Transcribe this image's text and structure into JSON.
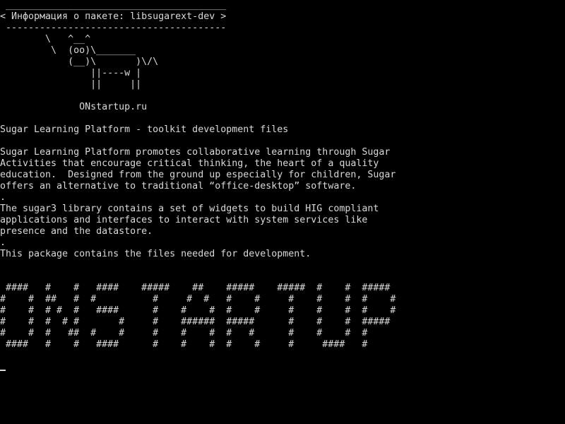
{
  "terminal": {
    "lines": [
      " _______________________________________",
      "< Информация о пакете: libsugarext-dev >",
      " ---------------------------------------",
      "        \\   ^__^",
      "         \\  (oo)\\_______",
      "            (__)\\       )\\/\\",
      "                ||----w |",
      "                ||     ||",
      "",
      "              ONstartup.ru",
      "",
      "Sugar Learning Platform - toolkit development files",
      "",
      "Sugar Learning Platform promotes collaborative learning through Sugar",
      "Activities that encourage critical thinking, the heart of a quality",
      "education.  Designed from the ground up especially for children, Sugar",
      "offers an alternative to traditional “office-desktop” software.",
      ".",
      "The sugar3 library contains a set of widgets to build HIG compliant",
      "applications and interfaces to interact with system services like",
      "presence and the datastore.",
      ".",
      "This package contains the files needed for development.",
      "",
      "",
      " ####   #    #   ####    #####    ##    #####    #####  #    #  #####",
      "#    #  ##   #  #          #     #  #   #    #     #    #    #  #    #",
      "#    #  # #  #   ####      #    #    #  #    #     #    #    #  #    #",
      "#    #  #  # #       #     #    ######  #####      #    #    #  #####",
      "#    #  #   ##  #    #     #    #    #  #   #      #    #    #  #",
      " ####   #    #   ####      #    #    #  #    #     #     ####   #"
    ]
  }
}
